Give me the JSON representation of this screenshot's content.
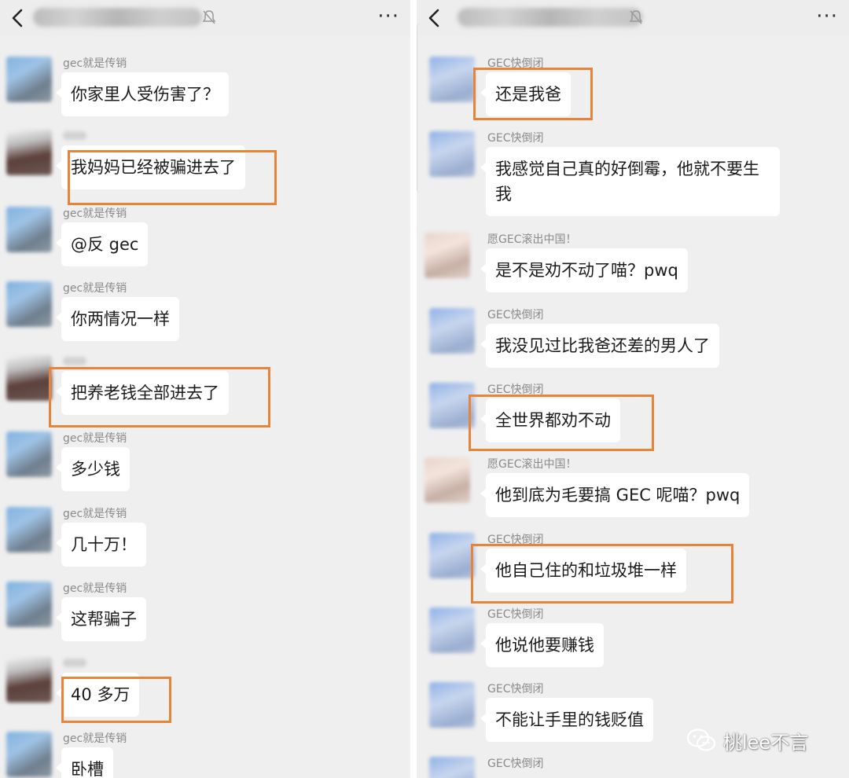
{
  "left": {
    "messages": [
      {
        "sender": "gec就是传销",
        "text": "你家里人受伤害了？"
      },
      {
        "sender": "",
        "text": "我妈妈已经被骗进去了"
      },
      {
        "sender": "gec就是传销",
        "text": "@反 gec"
      },
      {
        "sender": "gec就是传销",
        "text": "你两情况一样"
      },
      {
        "sender": "",
        "text": "把养老钱全部进去了"
      },
      {
        "sender": "gec就是传销",
        "text": "多少钱"
      },
      {
        "sender": "gec就是传销",
        "text": "几十万！"
      },
      {
        "sender": "gec就是传销",
        "text": "这帮骗子"
      },
      {
        "sender": "",
        "text": "40 多万"
      },
      {
        "sender": "gec就是传销",
        "text": "卧槽"
      }
    ]
  },
  "right": {
    "messages": [
      {
        "sender": "GEC快倒闭",
        "text": "还是我爸"
      },
      {
        "sender": "GEC快倒闭",
        "text": "我感觉自己真的好倒霉，他就不要生我"
      },
      {
        "sender": "愿GEC滚出中国！",
        "text": "是不是劝不动了喵？pwq"
      },
      {
        "sender": "GEC快倒闭",
        "text": "我没见过比我爸还差的男人了"
      },
      {
        "sender": "GEC快倒闭",
        "text": "全世界都劝不动"
      },
      {
        "sender": "愿GEC滚出中国！",
        "text": "他到底为毛要搞 GEC 呢喵？pwq"
      },
      {
        "sender": "GEC快倒闭",
        "text": "他自己住的和垃圾堆一样"
      },
      {
        "sender": "GEC快倒闭",
        "text": "他说他要赚钱"
      },
      {
        "sender": "GEC快倒闭",
        "text": "不能让手里的钱贬值"
      },
      {
        "sender": "GEC快倒闭",
        "text": ""
      }
    ]
  },
  "watermark": {
    "text": "桃lee不言"
  },
  "colors": {
    "highlight": "#e8833a",
    "background": "#efefef",
    "bubble": "#ffffff"
  },
  "icons": [
    "back-icon",
    "mute-icon",
    "more-icon",
    "wechat-icon"
  ]
}
